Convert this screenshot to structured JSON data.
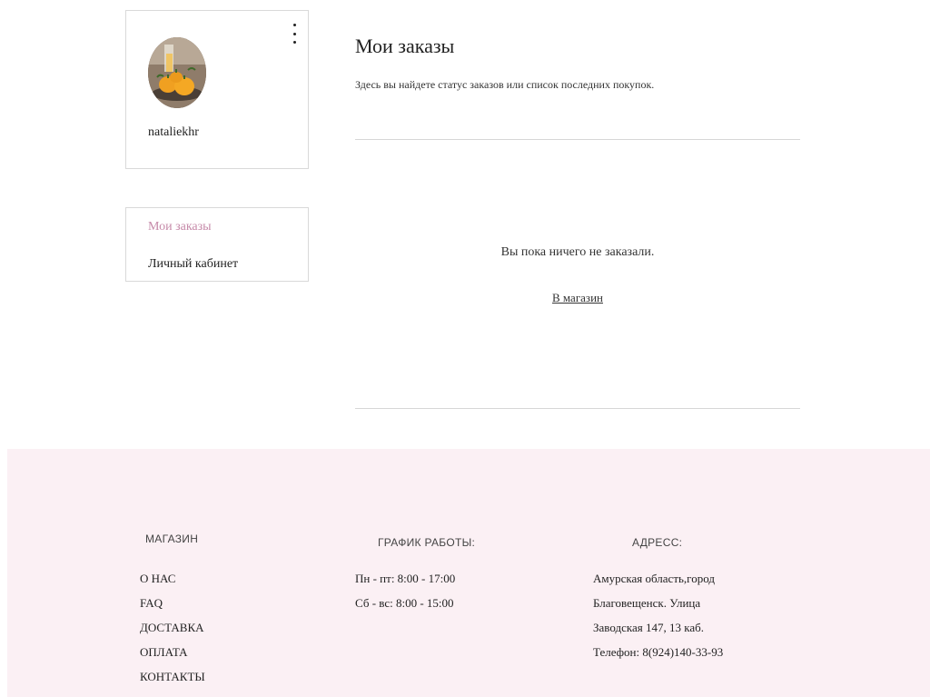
{
  "profile": {
    "username": "nataliekhr"
  },
  "nav": {
    "items": [
      {
        "label": "Мои заказы",
        "active": true
      },
      {
        "label": "Личный кабинет",
        "active": false
      }
    ]
  },
  "main": {
    "title": "Мои заказы",
    "subtitle": "Здесь вы найдете статус заказов или список последних покупок.",
    "empty_message": "Вы пока ничего не заказали.",
    "shop_link": "В магазин"
  },
  "footer": {
    "shop": {
      "heading": "МАГАЗИН",
      "links": [
        "О НАС",
        "FAQ",
        "ДОСТАВКА",
        "ОПЛАТА",
        "КОНТАКТЫ"
      ]
    },
    "schedule": {
      "heading": "ГРАФИК РАБОТЫ:",
      "lines": [
        "Пн - пт: 8:00 - 17:00",
        "Сб - вс: 8:00 - 15:00"
      ]
    },
    "address": {
      "heading": "АДРЕСС:",
      "lines": [
        "Амурская область,город",
        "Благовещенск. Улица",
        "Заводская 147, 13 каб.",
        "Телефон: 8(924)140-33-93"
      ]
    }
  },
  "colors": {
    "accent": "#c68aa9",
    "footer_bg": "#fbf0f4"
  }
}
